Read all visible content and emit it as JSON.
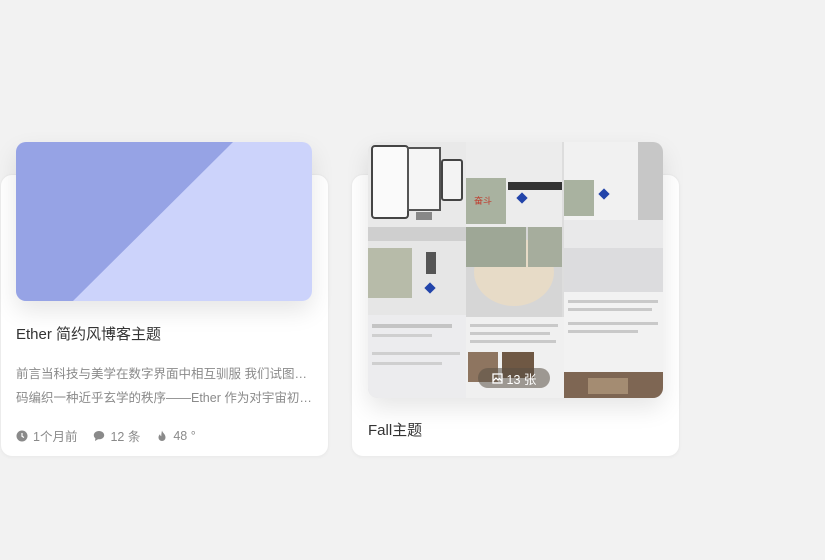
{
  "cards": [
    {
      "title": "Ether 简约风博客主题",
      "excerpt_line1": "前言当科技与美学在数字界面中相互驯服 我们试图用代",
      "excerpt_line2": "码编织一种近乎玄学的秩序——Ether 作为对宇宙初…",
      "meta": {
        "time": "1个月前",
        "comments": "12 条",
        "heat": "48 °"
      },
      "cover_colors": {
        "dark": "#96a3e5",
        "light": "#ccd3fb"
      }
    },
    {
      "title": "Fall主题",
      "image_count": "13 张"
    }
  ]
}
